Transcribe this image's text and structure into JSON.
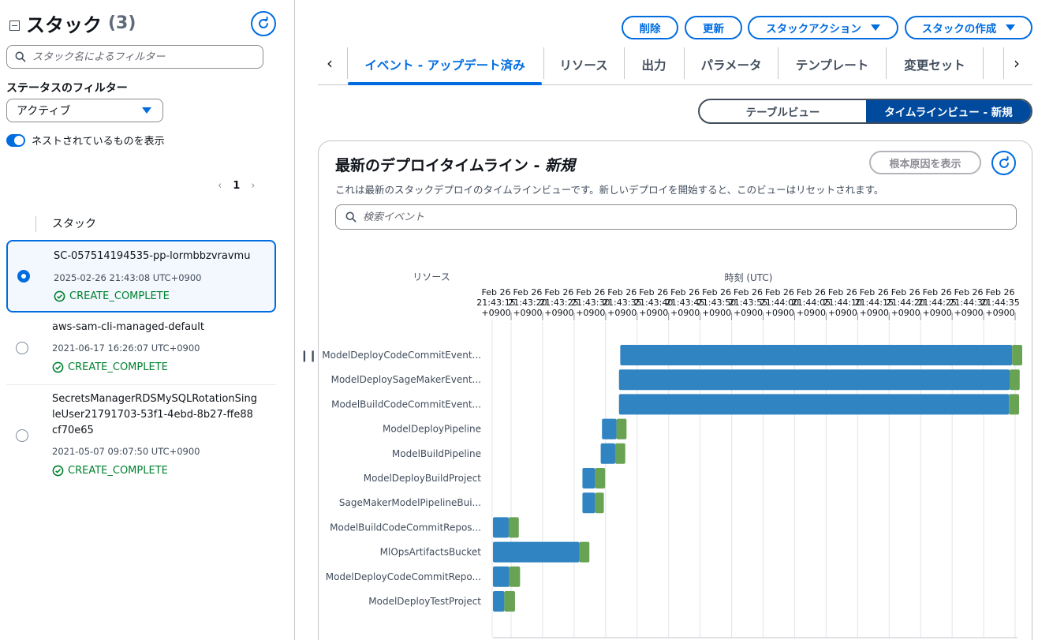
{
  "colors": {
    "accent": "#006ce0",
    "success": "#00802f",
    "bar_blue": "#3184c2",
    "bar_green": "#67a353"
  },
  "left_panel": {
    "title": "スタック",
    "count": "(3)",
    "search_placeholder": "スタック名によるフィルター",
    "filter_label": "ステータスのフィルター",
    "filter_value": "アクティブ",
    "nested_toggle_label": "ネストされているものを表示",
    "page": "1",
    "column_header": "スタック",
    "stacks": [
      {
        "name": "SC-057514194535-pp-lormbbzvravmu",
        "date": "2025-02-26 21:43:08 UTC+0900",
        "status": "CREATE_COMPLETE"
      },
      {
        "name": "aws-sam-cli-managed-default",
        "date": "2021-06-17 16:26:07 UTC+0900",
        "status": "CREATE_COMPLETE"
      },
      {
        "name": "SecretsManagerRDSMySQLRotationSingleUser21791703-53f1-4ebd-8b27-ffe88cf70e65",
        "date": "2021-05-07 09:07:50 UTC+0900",
        "status": "CREATE_COMPLETE"
      }
    ]
  },
  "actions": {
    "delete": "削除",
    "update": "更新",
    "stack_actions": "スタックアクション",
    "create_stack": "スタックの作成"
  },
  "tabs": [
    "イベント - アップデート済み",
    "リソース",
    "出力",
    "パラメータ",
    "テンプレート",
    "変更セット"
  ],
  "view_toggle": {
    "table": "テーブルビュー",
    "timeline": "タイムラインビュー - 新規"
  },
  "card": {
    "title": "最新のデプロイタイムライン - ",
    "title_suffix": "新規",
    "description": "これは最新のスタックデプロイのタイムラインビューです。新しいデプロイを開始すると、このビューはリセットされます。",
    "root_cause_button": "根本原因を表示",
    "search_placeholder": "検索イベント"
  },
  "chart_data": {
    "type": "gantt",
    "resource_label": "リソース",
    "time_label": "時刻 (UTC)",
    "ticks": [
      [
        "Feb 26",
        "21:43:15",
        "+0900"
      ],
      [
        "Feb 26",
        "21:43:20",
        "+0900"
      ],
      [
        "Feb 26",
        "21:43:25",
        "+0900"
      ],
      [
        "Feb 26",
        "21:43:30",
        "+0900"
      ],
      [
        "Feb 26",
        "21:43:35",
        "+0900"
      ],
      [
        "Feb 26",
        "21:43:40",
        "+0900"
      ],
      [
        "Feb 26",
        "21:43:45",
        "+0900"
      ],
      [
        "Feb 26",
        "21:43:50",
        "+0900"
      ],
      [
        "Feb 26",
        "21:43:55",
        "+0900"
      ],
      [
        "Feb 26",
        "21:44:00",
        "+0900"
      ],
      [
        "Feb 26",
        "21:44:05",
        "+0900"
      ],
      [
        "Feb 26",
        "21:44:10",
        "+0900"
      ],
      [
        "Feb 26",
        "21:44:15",
        "+0900"
      ],
      [
        "Feb 26",
        "21:44:20",
        "+0900"
      ],
      [
        "Feb 26",
        "21:44:25",
        "+0900"
      ],
      [
        "Feb 26",
        "21:44:30",
        "+0900"
      ],
      [
        "Feb 26",
        "21:44:35",
        "+0900"
      ]
    ],
    "time_range_seconds": [
      0,
      82
    ],
    "resources": [
      {
        "name": "ModelDeployCodeCommitEvent...",
        "start": 20.2,
        "end": 82.4,
        "complete": 84.0
      },
      {
        "name": "ModelDeploySageMakerEvent...",
        "start": 20.0,
        "end": 82.0,
        "complete": 83.6
      },
      {
        "name": "ModelBuildCodeCommitEvent...",
        "start": 20.0,
        "end": 81.9,
        "complete": 83.5
      },
      {
        "name": "ModelDeployPipeline",
        "start": 17.3,
        "end": 19.6,
        "complete": 21.2
      },
      {
        "name": "ModelBuildPipeline",
        "start": 17.1,
        "end": 19.4,
        "complete": 21.0
      },
      {
        "name": "ModelDeployBuildProject",
        "start": 14.2,
        "end": 16.2,
        "complete": 17.8
      },
      {
        "name": "SageMakerModelPipelineBui...",
        "start": 14.2,
        "end": 16.2,
        "complete": 17.6
      },
      {
        "name": "ModelBuildCodeCommitRepos...",
        "start": 0.0,
        "end": 2.5,
        "complete": 4.1
      },
      {
        "name": "MlOpsArtifactsBucket",
        "start": 0.0,
        "end": 13.7,
        "complete": 15.3
      },
      {
        "name": "ModelDeployCodeCommitRepo...",
        "start": 0.0,
        "end": 2.6,
        "complete": 4.3
      },
      {
        "name": "ModelDeployTestProject",
        "start": 0.0,
        "end": 1.8,
        "complete": 3.5
      }
    ]
  }
}
